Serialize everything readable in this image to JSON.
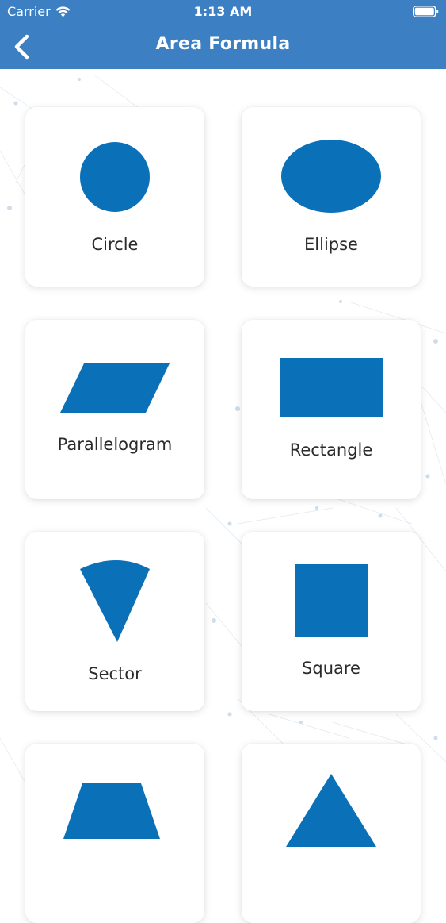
{
  "status_bar": {
    "carrier": "Carrier",
    "time": "1:13 AM"
  },
  "nav": {
    "title": "Area Formula",
    "back_icon": "chevron-left-icon"
  },
  "colors": {
    "bar_blue": "#3c7fc3",
    "shape_blue": "#0a70b8",
    "label_dark": "#2b2b2b"
  },
  "shapes": [
    {
      "label": "Circle",
      "icon": "circle-icon"
    },
    {
      "label": "Ellipse",
      "icon": "ellipse-icon"
    },
    {
      "label": "Parallelogram",
      "icon": "parallelogram-icon"
    },
    {
      "label": "Rectangle",
      "icon": "rectangle-icon"
    },
    {
      "label": "Sector",
      "icon": "sector-icon"
    },
    {
      "label": "Square",
      "icon": "square-icon"
    },
    {
      "label": "",
      "icon": "trapezoid-icon"
    },
    {
      "label": "",
      "icon": "triangle-icon"
    }
  ]
}
